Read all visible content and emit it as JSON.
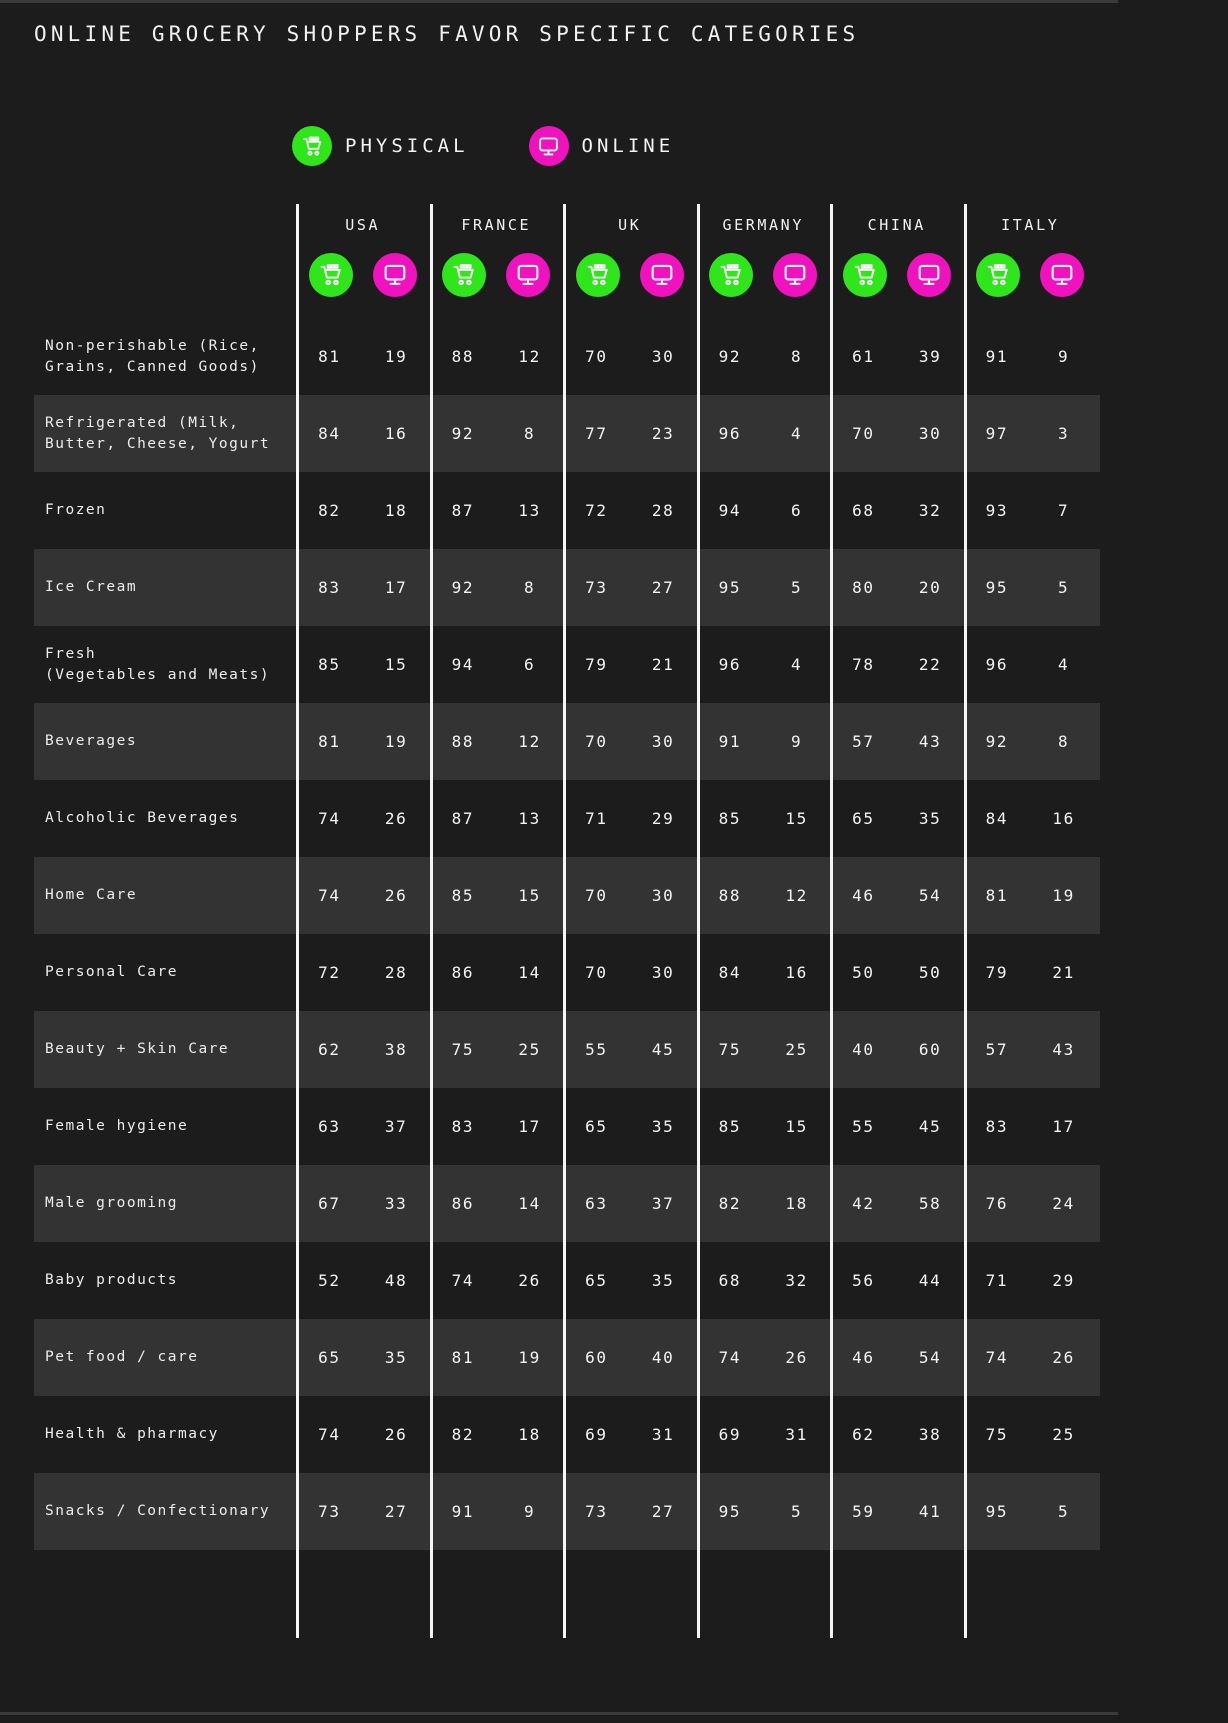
{
  "header": {
    "title": "ONLINE GROCERY SHOPPERS FAVOR SPECIFIC CATEGORIES"
  },
  "legend": {
    "items": [
      {
        "label": "PHYSICAL",
        "icon": "shopping-cart-icon",
        "color": "#2fe61b"
      },
      {
        "label": "ONLINE",
        "icon": "desktop-monitor-icon",
        "color": "#f012be"
      }
    ]
  },
  "chart_data": {
    "type": "table",
    "title": "ONLINE GROCERY SHOPPERS FAVOR SPECIFIC CATEGORIES",
    "legend": [
      "PHYSICAL",
      "ONLINE"
    ],
    "legend_position": "top",
    "countries": [
      "USA",
      "FRANCE",
      "UK",
      "GERMANY",
      "CHINA",
      "ITALY"
    ],
    "sub_headers": [
      "PHYSICAL",
      "ONLINE"
    ],
    "categories": [
      "Non-perishable (Rice, Grains, Canned Goods)",
      "Refrigerated (Milk, Butter, Cheese, Yogurt",
      "Frozen",
      "Ice Cream",
      "Fresh (Vegetables and Meats)",
      "Beverages",
      "Alcoholic Beverages",
      "Home Care",
      "Personal Care",
      "Beauty + Skin Care",
      "Female hygiene",
      "Male grooming",
      "Baby products",
      "Pet food / care",
      "Health & pharmacy",
      "Snacks / Confectionary"
    ],
    "rows": [
      {
        "category_lines": [
          "Non-perishable (Rice,",
          "Grains, Canned Goods)"
        ],
        "values": [
          [
            81,
            19
          ],
          [
            88,
            12
          ],
          [
            70,
            30
          ],
          [
            92,
            8
          ],
          [
            61,
            39
          ],
          [
            91,
            9
          ]
        ]
      },
      {
        "category_lines": [
          "Refrigerated (Milk,",
          "Butter, Cheese, Yogurt"
        ],
        "values": [
          [
            84,
            16
          ],
          [
            92,
            8
          ],
          [
            77,
            23
          ],
          [
            96,
            4
          ],
          [
            70,
            30
          ],
          [
            97,
            3
          ]
        ]
      },
      {
        "category_lines": [
          "Frozen"
        ],
        "values": [
          [
            82,
            18
          ],
          [
            87,
            13
          ],
          [
            72,
            28
          ],
          [
            94,
            6
          ],
          [
            68,
            32
          ],
          [
            93,
            7
          ]
        ]
      },
      {
        "category_lines": [
          "Ice Cream"
        ],
        "values": [
          [
            83,
            17
          ],
          [
            92,
            8
          ],
          [
            73,
            27
          ],
          [
            95,
            5
          ],
          [
            80,
            20
          ],
          [
            95,
            5
          ]
        ]
      },
      {
        "category_lines": [
          "Fresh",
          "(Vegetables and Meats)"
        ],
        "values": [
          [
            85,
            15
          ],
          [
            94,
            6
          ],
          [
            79,
            21
          ],
          [
            96,
            4
          ],
          [
            78,
            22
          ],
          [
            96,
            4
          ]
        ]
      },
      {
        "category_lines": [
          "Beverages"
        ],
        "values": [
          [
            81,
            19
          ],
          [
            88,
            12
          ],
          [
            70,
            30
          ],
          [
            91,
            9
          ],
          [
            57,
            43
          ],
          [
            92,
            8
          ]
        ]
      },
      {
        "category_lines": [
          "Alcoholic Beverages"
        ],
        "values": [
          [
            74,
            26
          ],
          [
            87,
            13
          ],
          [
            71,
            29
          ],
          [
            85,
            15
          ],
          [
            65,
            35
          ],
          [
            84,
            16
          ]
        ]
      },
      {
        "category_lines": [
          "Home Care"
        ],
        "values": [
          [
            74,
            26
          ],
          [
            85,
            15
          ],
          [
            70,
            30
          ],
          [
            88,
            12
          ],
          [
            46,
            54
          ],
          [
            81,
            19
          ]
        ]
      },
      {
        "category_lines": [
          "Personal Care"
        ],
        "values": [
          [
            72,
            28
          ],
          [
            86,
            14
          ],
          [
            70,
            30
          ],
          [
            84,
            16
          ],
          [
            50,
            50
          ],
          [
            79,
            21
          ]
        ]
      },
      {
        "category_lines": [
          "Beauty + Skin Care"
        ],
        "values": [
          [
            62,
            38
          ],
          [
            75,
            25
          ],
          [
            55,
            45
          ],
          [
            75,
            25
          ],
          [
            40,
            60
          ],
          [
            57,
            43
          ]
        ]
      },
      {
        "category_lines": [
          "Female hygiene"
        ],
        "values": [
          [
            63,
            37
          ],
          [
            83,
            17
          ],
          [
            65,
            35
          ],
          [
            85,
            15
          ],
          [
            55,
            45
          ],
          [
            83,
            17
          ]
        ]
      },
      {
        "category_lines": [
          "Male grooming"
        ],
        "values": [
          [
            67,
            33
          ],
          [
            86,
            14
          ],
          [
            63,
            37
          ],
          [
            82,
            18
          ],
          [
            42,
            58
          ],
          [
            76,
            24
          ]
        ]
      },
      {
        "category_lines": [
          "Baby products"
        ],
        "values": [
          [
            52,
            48
          ],
          [
            74,
            26
          ],
          [
            65,
            35
          ],
          [
            68,
            32
          ],
          [
            56,
            44
          ],
          [
            71,
            29
          ]
        ]
      },
      {
        "category_lines": [
          "Pet food / care"
        ],
        "values": [
          [
            65,
            35
          ],
          [
            81,
            19
          ],
          [
            60,
            40
          ],
          [
            74,
            26
          ],
          [
            46,
            54
          ],
          [
            74,
            26
          ]
        ]
      },
      {
        "category_lines": [
          "Health & pharmacy"
        ],
        "values": [
          [
            74,
            26
          ],
          [
            82,
            18
          ],
          [
            69,
            31
          ],
          [
            69,
            31
          ],
          [
            62,
            38
          ],
          [
            75,
            25
          ]
        ]
      },
      {
        "category_lines": [
          "Snacks / Confectionary"
        ],
        "values": [
          [
            73,
            27
          ],
          [
            91,
            9
          ],
          [
            73,
            27
          ],
          [
            95,
            5
          ],
          [
            59,
            41
          ],
          [
            95,
            5
          ]
        ]
      }
    ]
  }
}
